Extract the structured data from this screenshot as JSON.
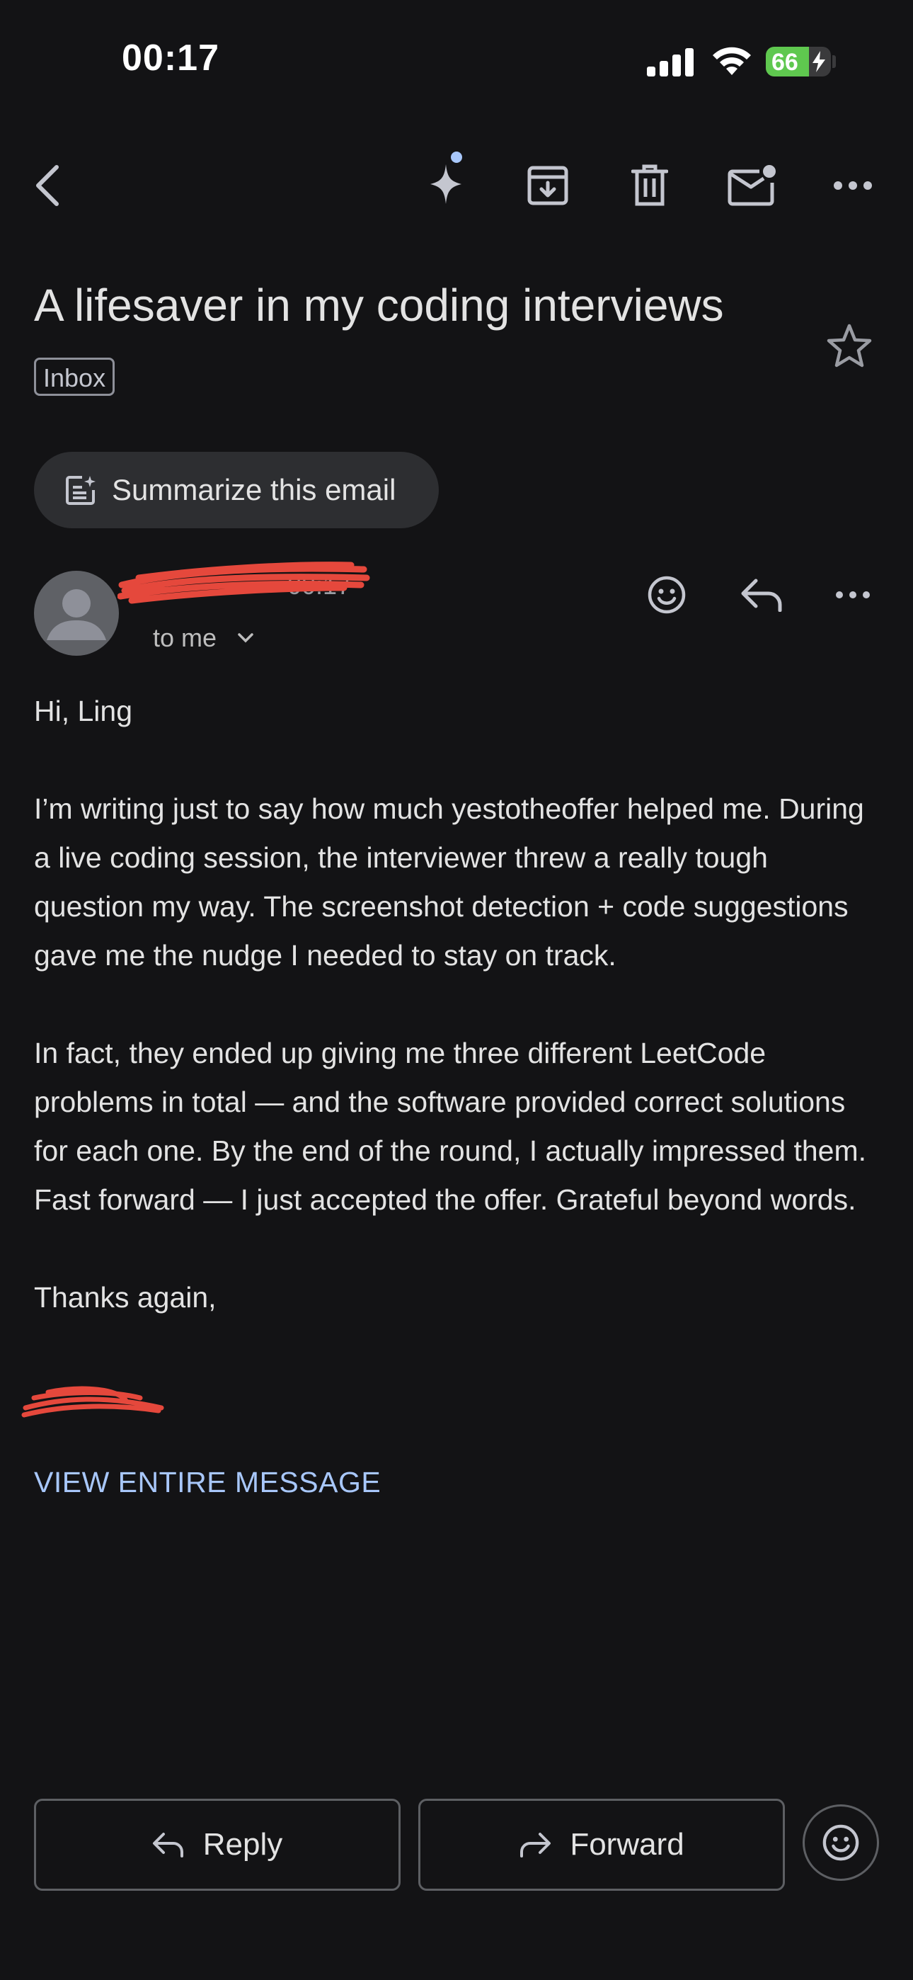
{
  "status_bar": {
    "time": "00:17",
    "battery_percent": "66",
    "battery_level": 0.66,
    "battery_color": "#5fc84f"
  },
  "toolbar": {
    "back_icon": "arrow-back-icon",
    "icons": [
      "gemini-sparkle-icon",
      "archive-icon",
      "delete-icon",
      "mark-unread-icon",
      "more-icon"
    ]
  },
  "email": {
    "subject": "A lifesaver in my coding interviews",
    "label": "Inbox",
    "summarize_label": "Summarize this email",
    "sender_time": "00:17",
    "recipient": "to me",
    "greeting": "Hi, Ling",
    "paragraph1": "I’m writing just to say how much yestotheoffer helped me. During a live coding session, the interviewer threw a really tough question my way. The screenshot detection + code suggestions gave me the nudge I needed to stay on track.",
    "paragraph2": "In fact, they ended up giving me three different LeetCode problems in total — and the software provided correct solutions for each one. By the end of the round, I actually impressed them. Fast forward — I just accepted the offer. Grateful beyond words.",
    "signoff": "Thanks again,",
    "view_entire": "VIEW ENTIRE MESSAGE"
  },
  "actions": {
    "reply_label": "Reply",
    "forward_label": "Forward"
  },
  "colors": {
    "background": "#131315",
    "link": "#a8c7fa",
    "redaction": "#e5483c",
    "sparkle_dot": "#a8c7fa"
  }
}
